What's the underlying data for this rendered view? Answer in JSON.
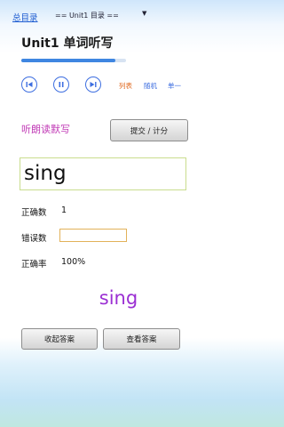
{
  "nav": {
    "home_link": "总目录",
    "unit_select": "== Unit1 目录 ==",
    "dropdown_glyph": "▼"
  },
  "page": {
    "title": "Unit1 单词听写",
    "progress_fraction": 0.9
  },
  "controls": {
    "prev_icon": "skip-previous-icon",
    "pause_icon": "pause-icon",
    "next_icon": "skip-next-icon",
    "mode_list": "列表",
    "mode_random": "随机",
    "mode_single": "单一",
    "active_color": "#e06a20",
    "inactive_color": "#3d6ee0"
  },
  "dictation": {
    "section_label": "听朗读默写",
    "submit_button": "提交 / 计分",
    "input_value": "sing"
  },
  "stats": {
    "correct_label": "正确数",
    "correct_value": "1",
    "wrong_label": "错误数",
    "wrong_value": "",
    "rate_label": "正确率",
    "rate_value": "100%"
  },
  "answer": {
    "word": "sing",
    "collapse_button": "收起答案",
    "show_button": "查看答案"
  }
}
